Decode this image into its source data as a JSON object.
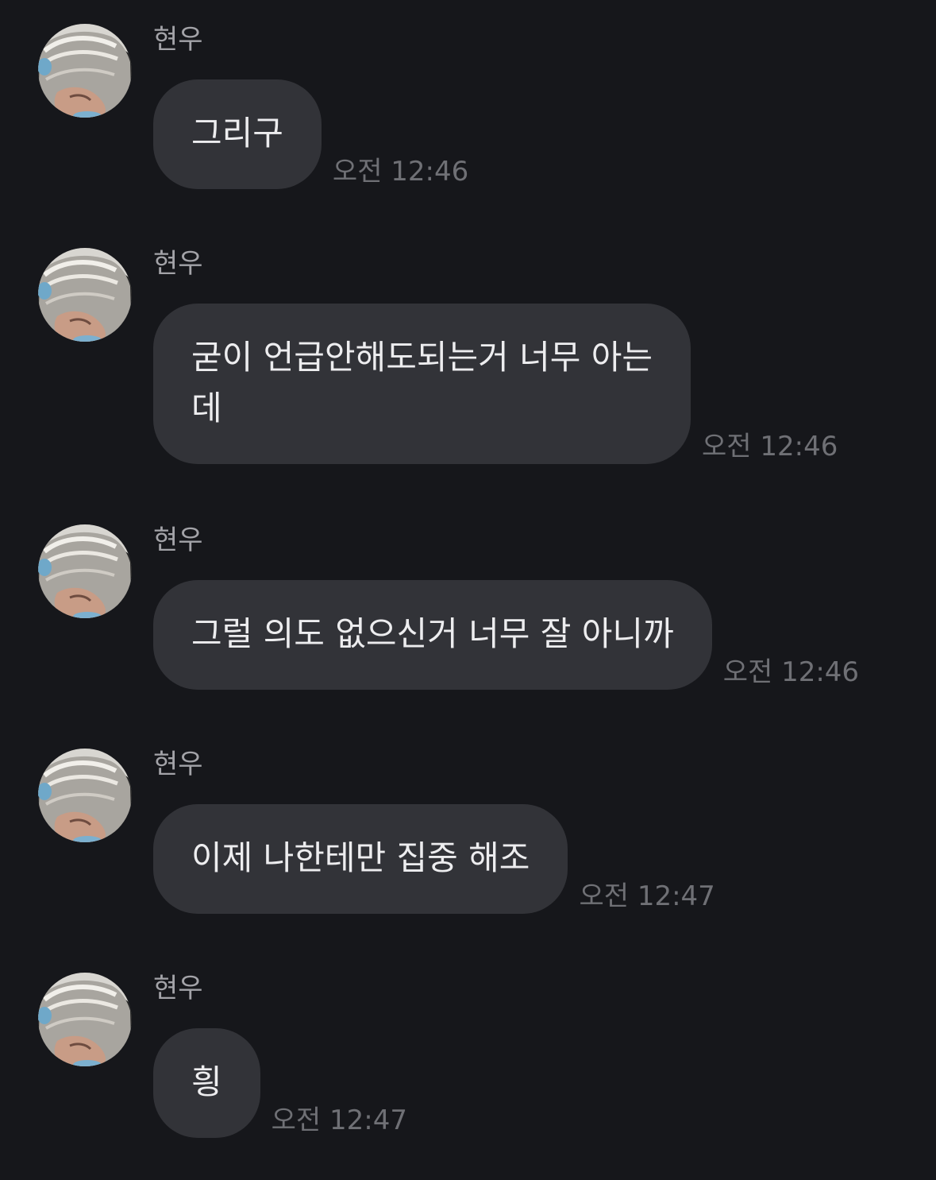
{
  "messages": [
    {
      "sender": "현우",
      "text": "그리구",
      "time": "오전 12:46"
    },
    {
      "sender": "현우",
      "text": "굳이 언급안해도되는거 너무 아는\n데",
      "time": "오전 12:46"
    },
    {
      "sender": "현우",
      "text": "그럴 의도 없으신거 너무 잘 아니까",
      "time": "오전 12:46"
    },
    {
      "sender": "현우",
      "text": "이제 나한테만 집중 해조",
      "time": "오전 12:47"
    },
    {
      "sender": "현우",
      "text": "힁",
      "time": "오전 12:47"
    }
  ],
  "avatar_icon": "profile-photo-icon",
  "colors": {
    "background": "#16171b",
    "bubble": "#323338",
    "text": "#ededef",
    "sender": "#a3a3a8",
    "time": "#6f7075"
  }
}
